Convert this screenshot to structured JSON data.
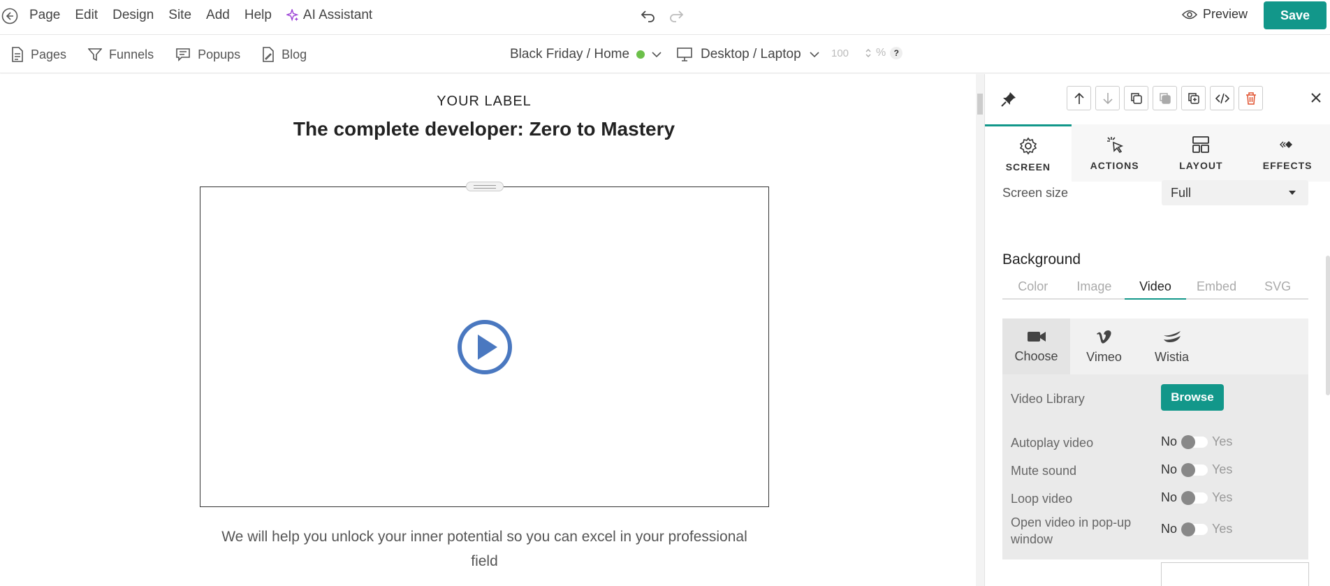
{
  "menu": {
    "items": [
      "Page",
      "Edit",
      "Design",
      "Site",
      "Add",
      "Help"
    ],
    "ai_assistant": "AI Assistant",
    "preview": "Preview",
    "save": "Save"
  },
  "subnav": {
    "items": [
      "Pages",
      "Funnels",
      "Popups",
      "Blog"
    ],
    "page_select": "Black Friday / Home",
    "device_select": "Desktop / Laptop",
    "zoom_value": "100",
    "zoom_unit": "%",
    "help": "?"
  },
  "canvas": {
    "label": "YOUR LABEL",
    "headline": "The complete developer: Zero to Mastery",
    "description": "We will help you unlock your inner potential so you can excel in your professional field"
  },
  "panel": {
    "tabs": [
      "SCREEN",
      "ACTIONS",
      "LAYOUT",
      "EFFECTS"
    ],
    "screen_size_label": "Screen size",
    "screen_size_value": "Full",
    "background_title": "Background",
    "background_tabs": [
      "Color",
      "Image",
      "Video",
      "Embed",
      "SVG"
    ],
    "video_sources": [
      "Choose",
      "Vimeo",
      "Wistia"
    ],
    "video_library_label": "Video Library",
    "browse": "Browse",
    "options": [
      "Autoplay video",
      "Mute sound",
      "Loop video",
      "Open video in pop-up window"
    ],
    "no": "No",
    "yes": "Yes"
  },
  "colors": {
    "accent": "#12978a",
    "play_icon": "#4a78c0",
    "status_dot": "#6cc04a",
    "delete_icon": "#e0502d"
  }
}
